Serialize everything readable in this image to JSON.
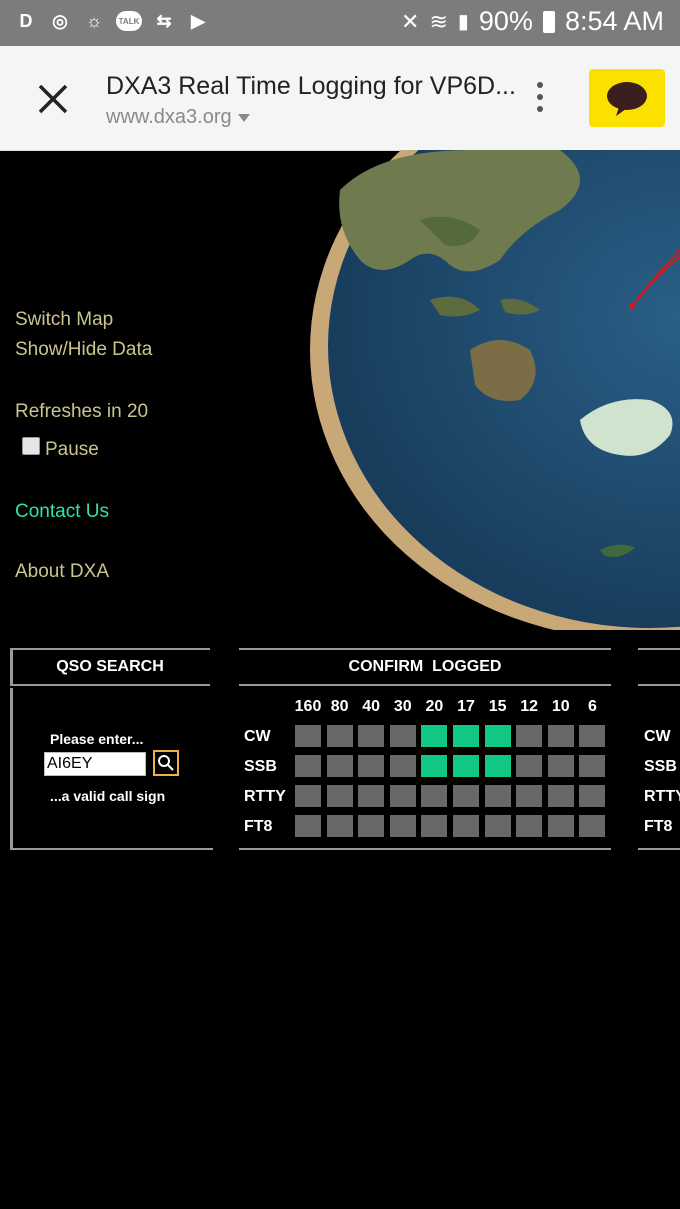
{
  "status_bar": {
    "battery": "90%",
    "time": "8:54 AM",
    "talk_badge": "TALK"
  },
  "tab": {
    "title": "DXA3 Real Time Logging for VP6D...",
    "url": "www.dxa3.org"
  },
  "nav": {
    "switch_map": "Switch Map",
    "show_hide": "Show/Hide Data",
    "refreshes": "Refreshes in 20",
    "pause": "Pause",
    "contact": "Contact Us",
    "about": "About DXA"
  },
  "qso": {
    "title": "QSO SEARCH",
    "prompt": "Please enter...",
    "value": "AI6EY",
    "hint": "...a valid call sign"
  },
  "confirm": {
    "title": "CONFIRM  LOGGED",
    "bands": [
      "160",
      "80",
      "40",
      "30",
      "20",
      "17",
      "15",
      "12",
      "10",
      "6"
    ],
    "modes": [
      "CW",
      "SSB",
      "RTTY",
      "FT8"
    ],
    "confirmed": {
      "CW": [
        0,
        0,
        0,
        0,
        1,
        1,
        1,
        0,
        0,
        0
      ],
      "SSB": [
        0,
        0,
        0,
        0,
        1,
        1,
        1,
        0,
        0,
        0
      ],
      "RTTY": [
        0,
        0,
        0,
        0,
        0,
        0,
        0,
        0,
        0,
        0
      ],
      "FT8": [
        0,
        0,
        0,
        0,
        0,
        0,
        0,
        0,
        0,
        0
      ]
    }
  },
  "right_panel": {
    "modes": [
      "CW",
      "SSB",
      "RTTY",
      "FT8"
    ]
  },
  "colors": {
    "confirmed": "#12c683",
    "unconfirmed": "#686868",
    "nav_text": "#c9c58c",
    "contact_text": "#2ee6a2"
  }
}
